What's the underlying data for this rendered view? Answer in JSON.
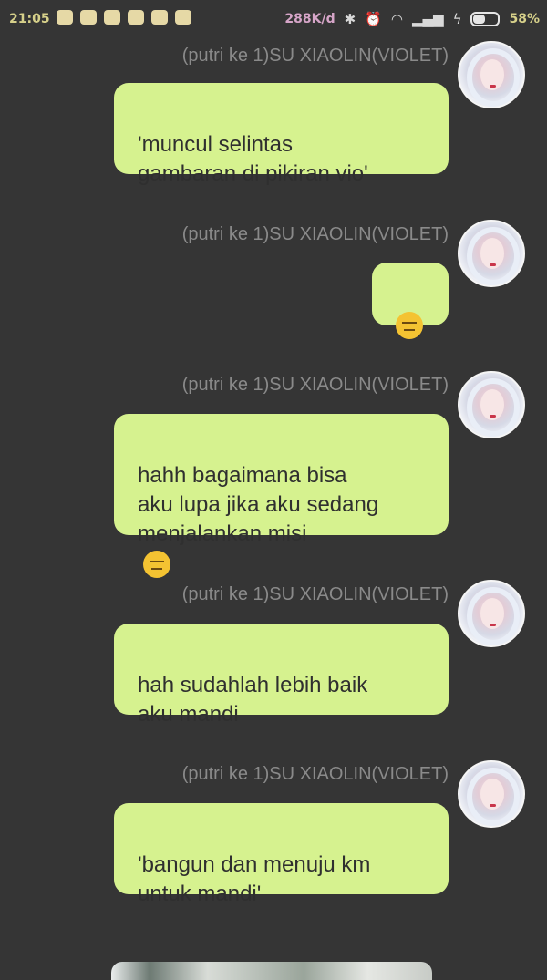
{
  "status_bar": {
    "time": "21:05",
    "speed": "288K/d",
    "battery": "58%",
    "battery_level": 0.58,
    "icons": [
      "bluetooth-icon",
      "alarm-icon",
      "wifi-icon",
      "signal-icon",
      "charging-icon",
      "battery-icon"
    ]
  },
  "messages": [
    {
      "sender": "(putri ke 1)SU XIAOLIN(VIOLET)",
      "text": "'muncul selintas\ngambaran di pikiran vio'"
    },
    {
      "sender": "(putri ke 1)SU XIAOLIN(VIOLET)",
      "text": "",
      "emoji": "expressionless-face-icon"
    },
    {
      "sender": "(putri ke 1)SU XIAOLIN(VIOLET)",
      "text": "hahh bagaimana bisa\naku lupa jika aku sedang\nmenjalankan misi",
      "emoji": "face-with-raised-eyebrow-icon"
    },
    {
      "sender": "(putri ke 1)SU XIAOLIN(VIOLET)",
      "text": "hah sudahlah lebih baik\naku mandi"
    },
    {
      "sender": "(putri ke 1)SU XIAOLIN(VIOLET)",
      "text": "'bangun dan menuju km\nuntuk mandi'"
    }
  ],
  "colors": {
    "background": "#353535",
    "bubble": "#d6f28f",
    "sender_text": "#8a8a8a",
    "message_text": "#2f2f2f"
  }
}
